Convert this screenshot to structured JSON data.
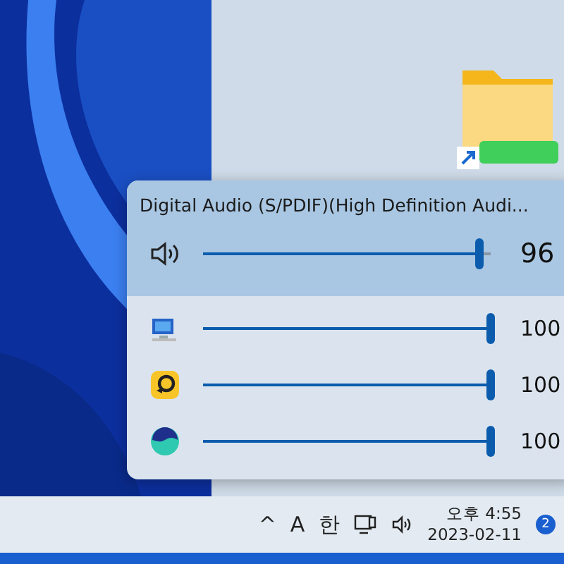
{
  "volume_mixer": {
    "device": "Digital Audio (S/PDIF)(High Definition Audi...",
    "master": {
      "level": 0.96,
      "reading": "96"
    },
    "apps": [
      {
        "kind": "system",
        "level": 1,
        "reading": "100"
      },
      {
        "kind": "remote",
        "level": 1,
        "reading": "100"
      },
      {
        "kind": "browser",
        "level": 1,
        "reading": "100"
      }
    ]
  },
  "taskbar": {
    "chevron": "^",
    "input_mode": "A",
    "ime": "한",
    "time": "오후 4:55",
    "date": "2023-02-11",
    "notification_count": "2"
  }
}
